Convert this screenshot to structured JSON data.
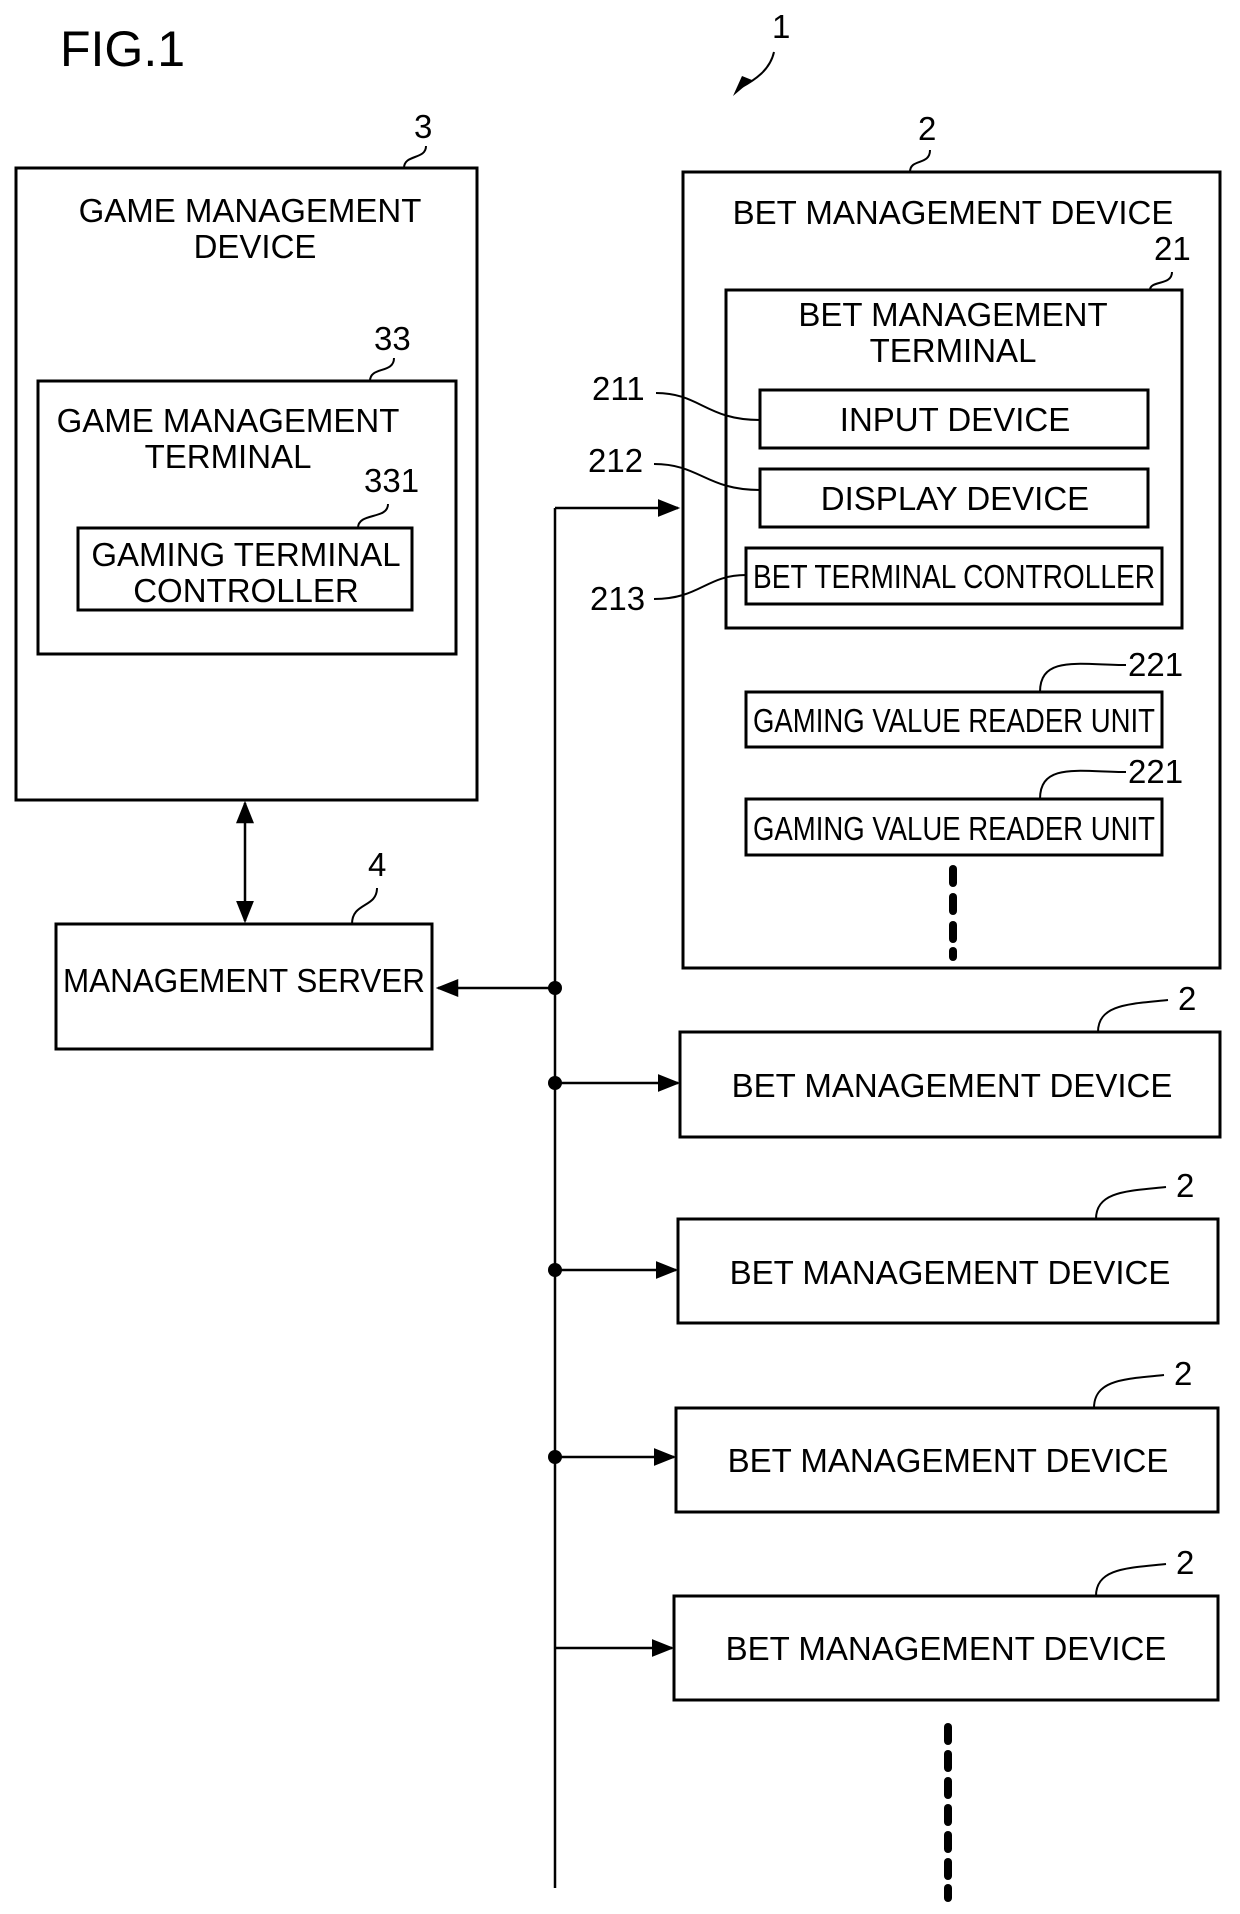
{
  "figure": {
    "title": "FIG.1",
    "system_ref": "1"
  },
  "game_management_device": {
    "ref": "3",
    "label_lines": [
      "GAME MANAGEMENT",
      "DEVICE"
    ],
    "terminal": {
      "ref": "33",
      "label_lines": [
        "GAME MANAGEMENT",
        "TERMINAL"
      ],
      "controller": {
        "ref": "331",
        "label_lines": [
          "GAMING TERMINAL",
          "CONTROLLER"
        ]
      }
    }
  },
  "management_server": {
    "ref": "4",
    "label": "MANAGEMENT SERVER"
  },
  "bet_management_device_main": {
    "ref": "2",
    "label": "BET MANAGEMENT DEVICE",
    "terminal": {
      "ref": "21",
      "label_lines": [
        "BET MANAGEMENT",
        "TERMINAL"
      ],
      "components": [
        {
          "ref": "211",
          "label": "INPUT DEVICE"
        },
        {
          "ref": "212",
          "label": "DISPLAY DEVICE"
        },
        {
          "ref": "213",
          "label": "BET TERMINAL CONTROLLER"
        }
      ]
    },
    "reader_units": [
      {
        "ref": "221",
        "label": "GAMING VALUE READER UNIT"
      },
      {
        "ref": "221",
        "label": "GAMING VALUE READER UNIT"
      }
    ]
  },
  "other_bet_devices": [
    {
      "ref": "2",
      "label": "BET MANAGEMENT DEVICE"
    },
    {
      "ref": "2",
      "label": "BET MANAGEMENT DEVICE"
    },
    {
      "ref": "2",
      "label": "BET MANAGEMENT DEVICE"
    },
    {
      "ref": "2",
      "label": "BET MANAGEMENT DEVICE"
    }
  ],
  "connections": [
    {
      "from": "game_management_device",
      "to": "management_server",
      "type": "bidirectional"
    },
    {
      "from": "network_bus",
      "to": "management_server",
      "type": "arrow"
    },
    {
      "from": "network_bus",
      "to": "bet_management_device_main",
      "type": "arrow"
    },
    {
      "from": "network_bus",
      "to": "other_bet_devices",
      "type": "arrow"
    }
  ]
}
